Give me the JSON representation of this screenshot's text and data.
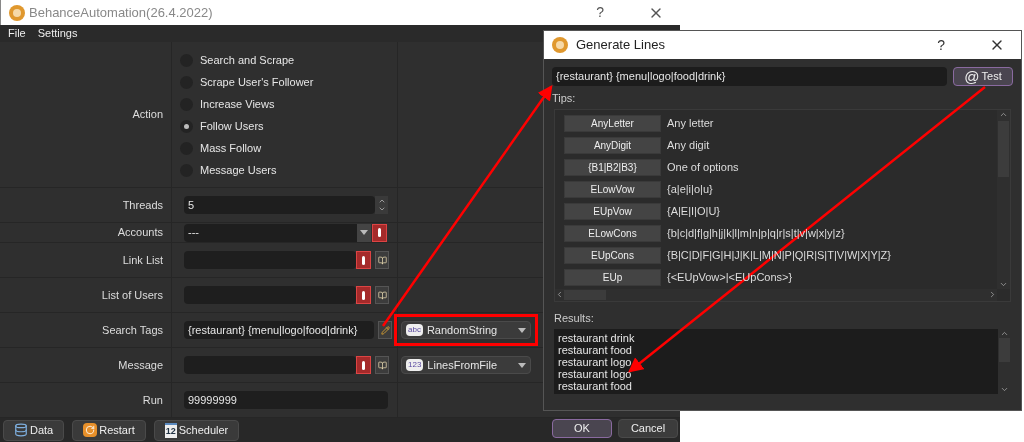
{
  "main_window": {
    "title": "BehanceAutomation(26.4.2022)",
    "help": "?",
    "menu": [
      "File",
      "Settings"
    ],
    "action": {
      "label": "Action",
      "options": [
        {
          "label": "Search and Scrape",
          "selected": false
        },
        {
          "label": "Scrape User's Follower",
          "selected": false
        },
        {
          "label": "Increase Views",
          "selected": false
        },
        {
          "label": "Follow Users",
          "selected": true
        },
        {
          "label": "Mass Follow",
          "selected": false
        },
        {
          "label": "Message Users",
          "selected": false
        }
      ]
    },
    "rows": [
      {
        "kind": "spin",
        "label": "Threads",
        "value": "5",
        "warning": false
      },
      {
        "kind": "combo",
        "label": "Accounts",
        "value": "---",
        "warning": true
      },
      {
        "kind": "file",
        "label": "Link List",
        "warning": true
      },
      {
        "kind": "file",
        "label": "List of Users",
        "warning": true
      },
      {
        "kind": "edit",
        "label": "Search Tags",
        "value": "{restaurant} {menu|logo|food|drink}",
        "warning": false,
        "source": {
          "badge": "abc",
          "label": "RandomString",
          "highlighted": true
        }
      },
      {
        "kind": "file",
        "label": "Message",
        "warning": true,
        "source": {
          "badge": "123",
          "label": "LinesFromFile",
          "highlighted": false
        }
      },
      {
        "kind": "text",
        "label": "Run",
        "value": "99999999",
        "warning": false
      }
    ],
    "buttons": [
      {
        "kind": "data",
        "label": "Data"
      },
      {
        "kind": "restart",
        "label": "Restart"
      },
      {
        "kind": "scheduler",
        "label": "Scheduler",
        "badge": "12"
      }
    ]
  },
  "dialog": {
    "title": "Generate Lines",
    "help": "?",
    "input": "{restaurant} {menu|logo|food|drink}",
    "test": {
      "glyph": "@",
      "label": "Test"
    },
    "tips_label": "Tips:",
    "tips": [
      {
        "button": "AnyLetter",
        "text": "Any letter"
      },
      {
        "button": "AnyDigit",
        "text": "Any digit"
      },
      {
        "button": "{B1|B2|B3}",
        "text": "One of options"
      },
      {
        "button": "ELowVow",
        "text": "{a|e|i|o|u}"
      },
      {
        "button": "EUpVow",
        "text": "{A|E|I|O|U}"
      },
      {
        "button": "ELowCons",
        "text": "{b|c|d|f|g|h|j|k|l|m|n|p|q|r|s|t|v|w|x|y|z}"
      },
      {
        "button": "EUpCons",
        "text": "{B|C|D|F|G|H|J|K|L|M|N|P|Q|R|S|T|V|W|X|Y|Z}"
      },
      {
        "button": "EUp",
        "text": "{<EUpVow>|<EUpCons>}"
      }
    ],
    "results_label": "Results:",
    "results": [
      "restaurant drink",
      "restaurant food",
      "restaurant logo",
      "restaurant logo",
      "restaurant food"
    ],
    "buttons": [
      {
        "label": "OK",
        "default": true
      },
      {
        "label": "Cancel",
        "default": false
      }
    ]
  }
}
